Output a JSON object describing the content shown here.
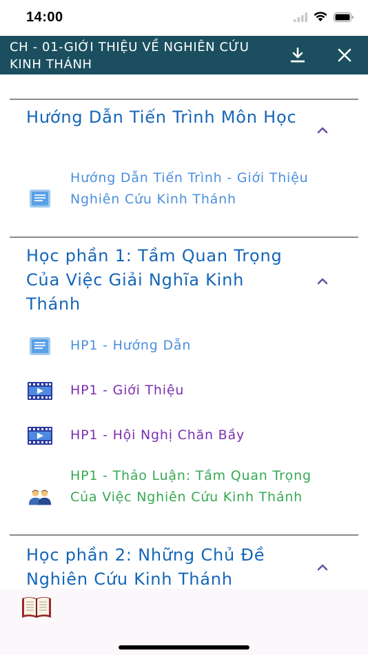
{
  "status_bar": {
    "time": "14:00"
  },
  "app_bar": {
    "title": "CH - 01-GIỚI THIỆU VỀ NGHIÊN CỨU KINH THÁNH",
    "download_icon": "download-icon",
    "close_icon": "close-icon",
    "background": "#1b4f5f"
  },
  "sections": [
    {
      "title": "Hướng Dẫn Tiến Trình Môn Học",
      "expanded": true,
      "items": [
        {
          "label": "Hướng Dẫn Tiến Trình - Giới Thiệu Nghiên Cứu Kinh Thánh",
          "type": "document",
          "icon": "document-icon"
        }
      ]
    },
    {
      "title": "Học phần 1: Tầm Quan Trọng Của Việc Giải Nghĩa Kinh Thánh",
      "expanded": true,
      "items": [
        {
          "label": "HP1 - Hướng Dẫn",
          "type": "document",
          "icon": "document-icon"
        },
        {
          "label": "HP1 - Giới Thiệu",
          "type": "video",
          "icon": "video-icon"
        },
        {
          "label": "HP1 - Hội Nghị Chăn Bầy",
          "type": "video",
          "icon": "video-icon"
        },
        {
          "label": "HP1 - Thảo Luận: Tầm Quan Trọng Của Việc Nghiên Cứu Kinh Thánh",
          "type": "discussion",
          "icon": "discussion-icon"
        }
      ]
    },
    {
      "title": "Học phần 2: Những Chủ Đề Nghiên Cứu Kinh Thánh",
      "expanded": true,
      "items": []
    }
  ],
  "colors": {
    "section_title": "#1565b8",
    "document_label": "#4a8fdc",
    "video_label": "#7b2fb0",
    "discussion_label": "#36a853",
    "chevron": "#6a4fa0"
  },
  "bottom_bar": {
    "icon": "book-icon"
  }
}
